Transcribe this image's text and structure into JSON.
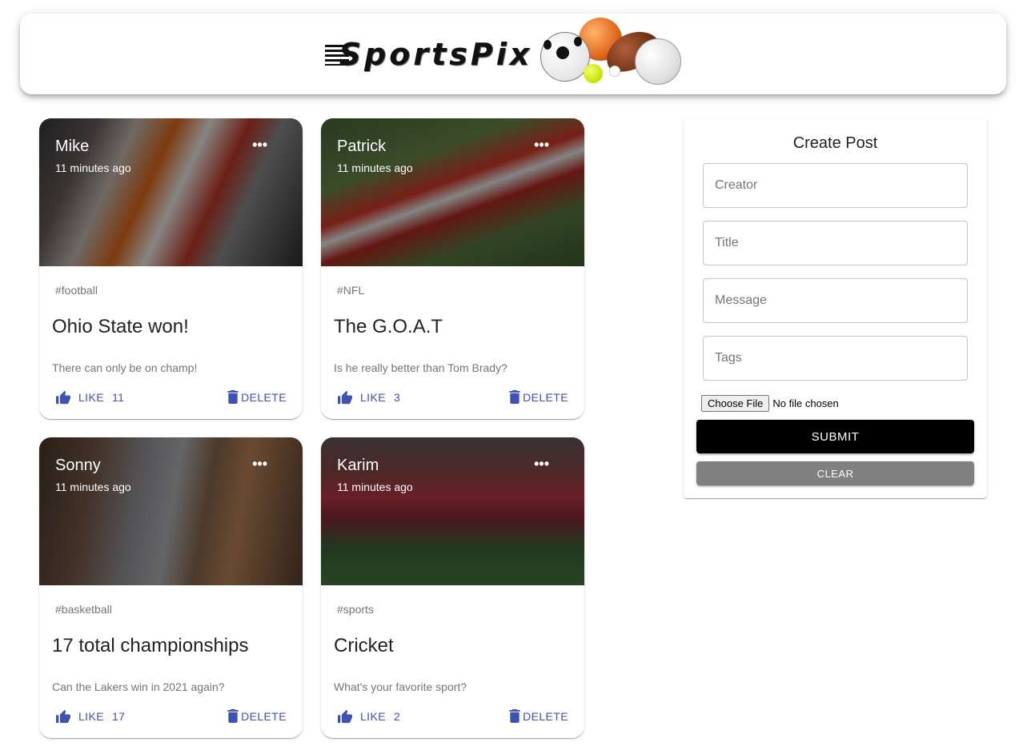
{
  "app": {
    "logo_text": "SportsPix"
  },
  "posts": [
    {
      "creator": "Mike",
      "time": "11 minutes ago",
      "tags": "#football",
      "title": "Ohio State won!",
      "message": "There can only be on champ!",
      "like_label": "LIKE",
      "like_count": "11",
      "delete_label": "DELETE"
    },
    {
      "creator": "Patrick",
      "time": "11 minutes ago",
      "tags": "#NFL",
      "title": "The G.O.A.T",
      "message": "Is he really better than Tom Brady?",
      "like_label": "LIKE",
      "like_count": "3",
      "delete_label": "DELETE"
    },
    {
      "creator": "Sonny",
      "time": "11 minutes ago",
      "tags": "#basketball",
      "title": "17 total championships",
      "message": "Can the Lakers win in 2021 again?",
      "like_label": "LIKE",
      "like_count": "17",
      "delete_label": "DELETE"
    },
    {
      "creator": "Karim",
      "time": "11 minutes ago",
      "tags": "#sports",
      "title": "Cricket",
      "message": "What's your favorite sport?",
      "like_label": "LIKE",
      "like_count": "2",
      "delete_label": "DELETE"
    }
  ],
  "form": {
    "title": "Create Post",
    "creator_placeholder": "Creator",
    "title_placeholder": "Title",
    "message_placeholder": "Message",
    "tags_placeholder": "Tags",
    "file_button": "Choose File",
    "file_status": "No file chosen",
    "submit_label": "SUBMIT",
    "clear_label": "CLEAR"
  },
  "colors": {
    "accent": "#3f51b5",
    "submit_bg": "#000000",
    "clear_bg": "#808080"
  },
  "icons": [
    "thumb-up-icon",
    "delete-icon",
    "more-horiz-icon"
  ]
}
